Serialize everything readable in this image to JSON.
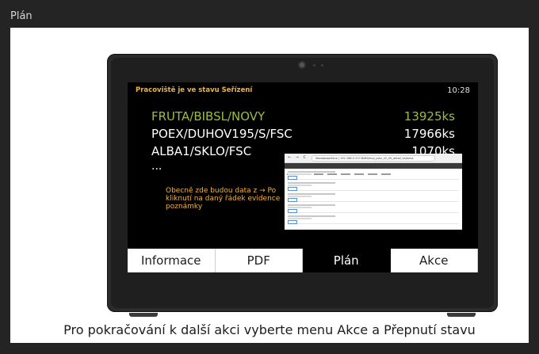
{
  "page_label": "Plán",
  "caption": "Pro pokračování k další akci vyberte menu Akce a Přepnutí stavu",
  "screen": {
    "status": "Pracoviště je ve stavu Seřízení",
    "time": "10:28",
    "jobs": [
      {
        "name": "FRUTA/BIBSL/NOVY",
        "qty": "13925ks",
        "color": "#9bbd3c"
      },
      {
        "name": "POEX/DUHOV195/S/FSC",
        "qty": "17966ks",
        "color": "#ffffff"
      },
      {
        "name": "ALBA1/SKLO/FSC",
        "qty": "1070ks",
        "color": "#ffffff"
      }
    ],
    "ellipsis": "...",
    "note": "Obecně zde budou data z → Po kliknutí na daný řádek evidence poznámky",
    "browser": {
      "nav": "← → C",
      "address": "Nezabezpečeno | 192.168.0.227:8080/mpi_plan_v2_05_detail_tiskarna"
    },
    "menu": {
      "items": [
        "Informace",
        "PDF",
        "Plán",
        "Akce"
      ],
      "active_index": 2
    }
  }
}
